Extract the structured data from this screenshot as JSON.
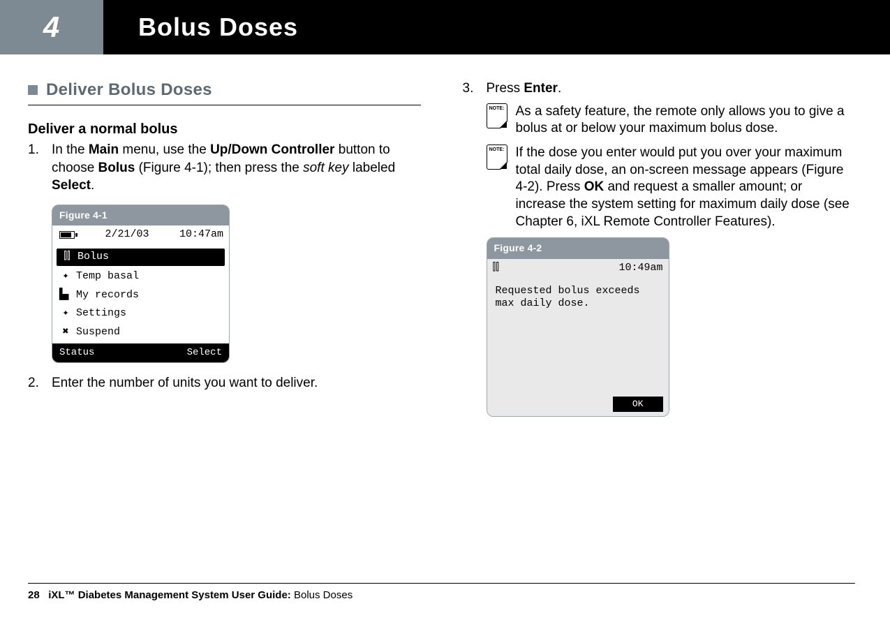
{
  "header": {
    "chapter": "4",
    "title": "Bolus Doses"
  },
  "left": {
    "section_title": "Deliver Bolus Doses",
    "subhead": "Deliver a normal bolus",
    "step1": {
      "num": "1.",
      "pre": "In the ",
      "b1": "Main",
      "mid1": " menu, use the ",
      "b2": "Up/Down Controller",
      "mid2": " button to choose ",
      "b3": "Bolus",
      "mid3": " (Figure 4-1); then press the ",
      "soft": "soft key",
      "mid4": " labeled ",
      "b4": "Select",
      "end": "."
    },
    "fig1": {
      "label": "Figure 4-1",
      "date": "2/21/03",
      "time": "10:47am",
      "items": [
        {
          "icon": "bolus-icon",
          "glyph": "⫿⫿",
          "label": "Bolus",
          "selected": true
        },
        {
          "icon": "temp-basal-icon",
          "glyph": "✦",
          "label": "Temp basal",
          "selected": false
        },
        {
          "icon": "my-records-icon",
          "glyph": "▙▖",
          "label": "My records",
          "selected": false
        },
        {
          "icon": "settings-icon",
          "glyph": "✦",
          "label": "Settings",
          "selected": false
        },
        {
          "icon": "suspend-icon",
          "glyph": "✖",
          "label": "Suspend",
          "selected": false
        }
      ],
      "soft_left": "Status",
      "soft_right": "Select"
    },
    "step2": {
      "num": "2.",
      "text": "Enter the number of units you want to deliver."
    }
  },
  "right": {
    "step3": {
      "num": "3.",
      "pre": "Press ",
      "b1": "Enter",
      "end": "."
    },
    "note1": "As a safety feature, the remote only allows you to give a bolus at or below your maximum bolus dose.",
    "note2": {
      "pre": "If the dose you enter would put you over your maximum total daily dose, an on-screen message appears (Figure 4-2). Press ",
      "b1": "OK",
      "post": " and request a smaller amount; or increase the system setting for maximum daily dose (see Chapter 6, iXL Remote Controller Features)."
    },
    "fig2": {
      "label": "Figure 4-2",
      "time": "10:49am",
      "message": "Requested bolus exceeds max daily dose.",
      "ok": "OK"
    },
    "note_label": "NOTE:"
  },
  "footer": {
    "page": "28",
    "bold": "iXL™ Diabetes Management System User Guide: ",
    "plain": "Bolus Doses"
  }
}
